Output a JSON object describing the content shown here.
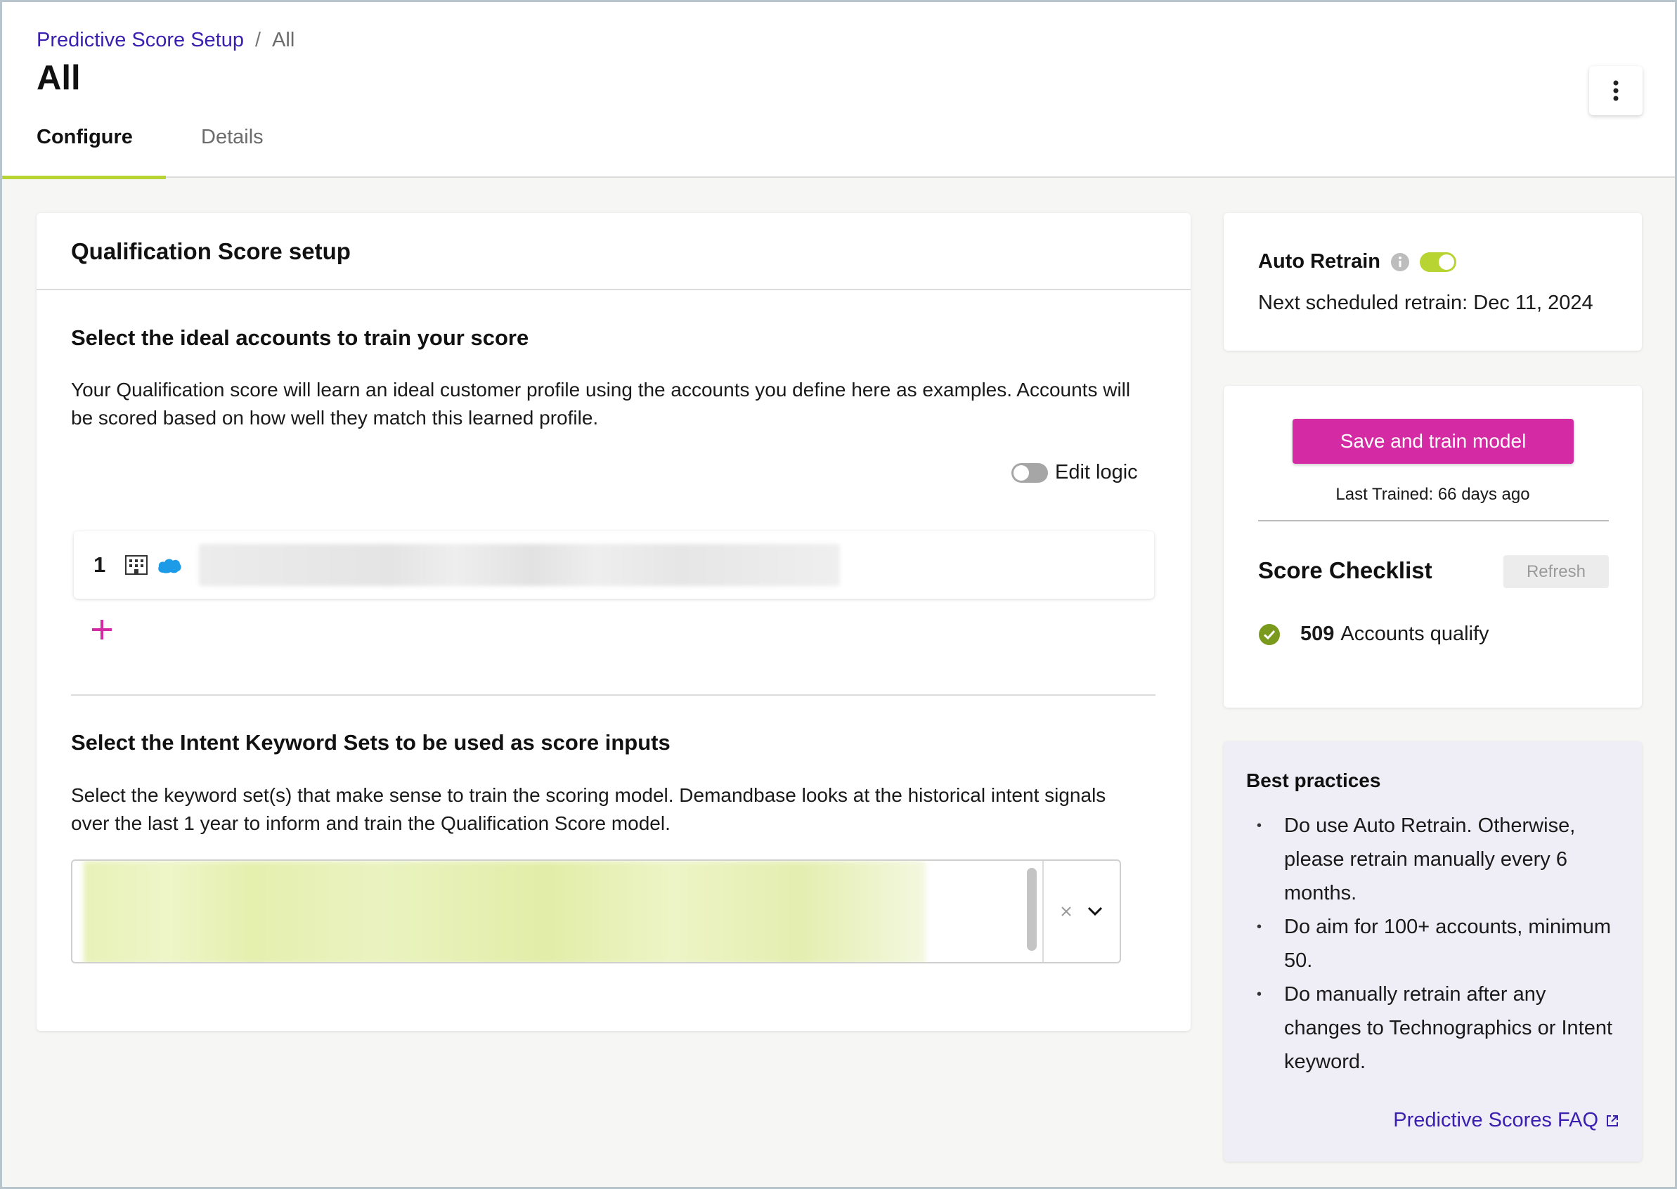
{
  "breadcrumb": {
    "parent": "Predictive Score Setup",
    "separator": "/",
    "current": "All"
  },
  "page_title": "All",
  "tabs": [
    {
      "label": "Configure",
      "active": true
    },
    {
      "label": "Details",
      "active": false
    }
  ],
  "main": {
    "card_title": "Qualification Score setup",
    "accounts_section": {
      "title": "Select the ideal accounts to train your score",
      "description": "Your Qualification score will learn an ideal customer profile using the accounts you define here as examples. Accounts will be scored based on how well they match this learned profile.",
      "edit_logic_label": "Edit logic",
      "rule_number": "1"
    },
    "keywords_section": {
      "title": "Select the Intent Keyword Sets to be used as score inputs",
      "description": "Select the keyword set(s) that make sense to train the scoring model. Demandbase looks at the historical intent signals over the last 1 year to inform and train the Qualification Score model."
    }
  },
  "sidebar": {
    "auto_retrain": {
      "label": "Auto Retrain",
      "enabled": true,
      "next_label": "Next scheduled retrain:",
      "next_date": "Dec 11, 2024"
    },
    "train": {
      "button_label": "Save and train model",
      "last_trained": "Last Trained: 66 days ago"
    },
    "checklist": {
      "title": "Score Checklist",
      "refresh_label": "Refresh",
      "count": "509",
      "count_label": "Accounts qualify"
    },
    "best_practices": {
      "title": "Best practices",
      "items": [
        "Do use Auto Retrain. Otherwise, please retrain manually every 6 months.",
        "Do aim for 100+ accounts, minimum 50.",
        "Do manually retrain after any changes to Technographics or Intent keyword."
      ],
      "faq_label": "Predictive Scores FAQ"
    }
  },
  "colors": {
    "brand_link": "#3a1fb0",
    "accent_green": "#b7d433",
    "primary_button": "#d42aa3",
    "check_green": "#7a9a1e"
  }
}
